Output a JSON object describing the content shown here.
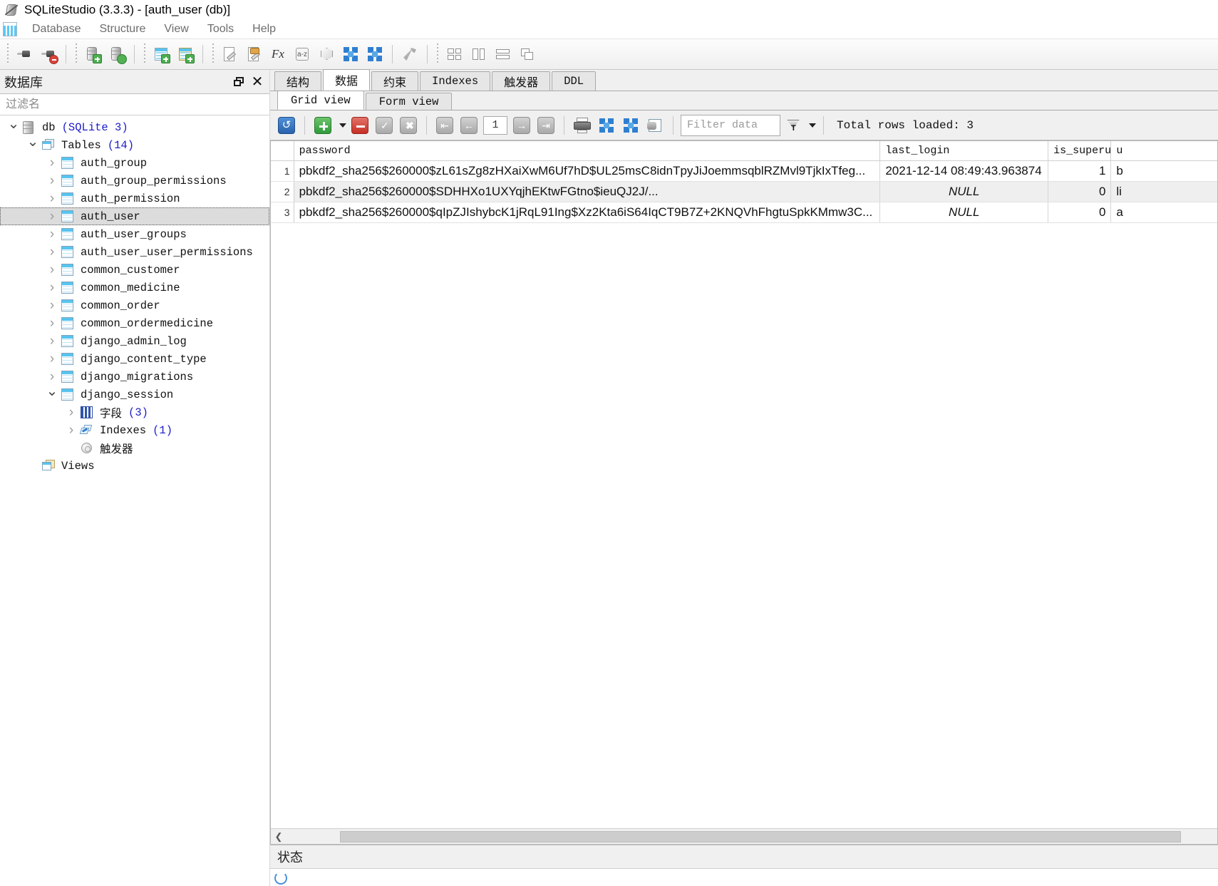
{
  "window": {
    "title": "SQLiteStudio (3.3.3) - [auth_user (db)]",
    "app_icon": "sqlite-logo-icon"
  },
  "menubar": {
    "items": [
      {
        "label": "Database",
        "name": "menu-database"
      },
      {
        "label": "Structure",
        "name": "menu-structure"
      },
      {
        "label": "View",
        "name": "menu-view"
      },
      {
        "label": "Tools",
        "name": "menu-tools"
      },
      {
        "label": "Help",
        "name": "menu-help"
      }
    ]
  },
  "toolbar": {
    "buttons": [
      {
        "name": "connect-to-database-button",
        "icon": "plug-connect-icon"
      },
      {
        "name": "disconnect-from-database-button",
        "icon": "plug-disconnect-icon"
      },
      {
        "name": "add-database-button",
        "icon": "database-add-icon"
      },
      {
        "name": "edit-database-button",
        "icon": "database-edit-icon"
      },
      {
        "name": "create-table-button",
        "icon": "table-add-icon"
      },
      {
        "name": "create-index-button",
        "icon": "index-add-icon"
      },
      {
        "name": "open-sql-editor-button",
        "icon": "sql-editor-icon"
      },
      {
        "name": "open-function-editor-button",
        "icon": "function-editor-icon"
      },
      {
        "name": "custom-sql-functions-button",
        "icon": "fx-icon"
      },
      {
        "name": "collations-editor-button",
        "icon": "a-z-icon"
      },
      {
        "name": "extensions-button",
        "icon": "cube-icon"
      },
      {
        "name": "import-button",
        "icon": "import-icon"
      },
      {
        "name": "export-button",
        "icon": "export-icon"
      },
      {
        "name": "open-configuration-button",
        "icon": "wrench-icon"
      },
      {
        "name": "tile-windows-button",
        "icon": "tile-windows-icon"
      },
      {
        "name": "tile-vertically-button",
        "icon": "tile-vertical-icon"
      },
      {
        "name": "tile-horizontally-button",
        "icon": "tile-horizontal-icon"
      },
      {
        "name": "cascade-windows-button",
        "icon": "cascade-windows-icon"
      }
    ]
  },
  "sidebar": {
    "title": "数据库",
    "float_icon": "restore-window-icon",
    "close_icon": "close-icon",
    "filter_placeholder": "过滤名",
    "tree": [
      {
        "label": "db",
        "suffix": "(SQLite 3)",
        "icon": "database-icon",
        "arrow": "down",
        "indent": 0,
        "name": "tree-node-db"
      },
      {
        "label": "Tables",
        "suffix": "(14)",
        "icon": "tables-folder-icon",
        "arrow": "down",
        "indent": 1,
        "name": "tree-node-tables"
      },
      {
        "label": "auth_group",
        "suffix": "",
        "icon": "table-icon",
        "arrow": "right",
        "indent": 2,
        "name": "tree-node-auth-group"
      },
      {
        "label": "auth_group_permissions",
        "suffix": "",
        "icon": "table-icon",
        "arrow": "right",
        "indent": 2,
        "name": "tree-node-auth-group-permissions"
      },
      {
        "label": "auth_permission",
        "suffix": "",
        "icon": "table-icon",
        "arrow": "right",
        "indent": 2,
        "name": "tree-node-auth-permission"
      },
      {
        "label": "auth_user",
        "suffix": "",
        "icon": "table-icon",
        "arrow": "right",
        "indent": 2,
        "selected": true,
        "name": "tree-node-auth-user"
      },
      {
        "label": "auth_user_groups",
        "suffix": "",
        "icon": "table-icon",
        "arrow": "right",
        "indent": 2,
        "name": "tree-node-auth-user-groups"
      },
      {
        "label": "auth_user_user_permissions",
        "suffix": "",
        "icon": "table-icon",
        "arrow": "right",
        "indent": 2,
        "name": "tree-node-auth-user-user-permissions"
      },
      {
        "label": "common_customer",
        "suffix": "",
        "icon": "table-icon",
        "arrow": "right",
        "indent": 2,
        "name": "tree-node-common-customer"
      },
      {
        "label": "common_medicine",
        "suffix": "",
        "icon": "table-icon",
        "arrow": "right",
        "indent": 2,
        "name": "tree-node-common-medicine"
      },
      {
        "label": "common_order",
        "suffix": "",
        "icon": "table-icon",
        "arrow": "right",
        "indent": 2,
        "name": "tree-node-common-order"
      },
      {
        "label": "common_ordermedicine",
        "suffix": "",
        "icon": "table-icon",
        "arrow": "right",
        "indent": 2,
        "name": "tree-node-common-ordermedicine"
      },
      {
        "label": "django_admin_log",
        "suffix": "",
        "icon": "table-icon",
        "arrow": "right",
        "indent": 2,
        "name": "tree-node-django-admin-log"
      },
      {
        "label": "django_content_type",
        "suffix": "",
        "icon": "table-icon",
        "arrow": "right",
        "indent": 2,
        "name": "tree-node-django-content-type"
      },
      {
        "label": "django_migrations",
        "suffix": "",
        "icon": "table-icon",
        "arrow": "right",
        "indent": 2,
        "name": "tree-node-django-migrations"
      },
      {
        "label": "django_session",
        "suffix": "",
        "icon": "table-icon",
        "arrow": "down",
        "indent": 2,
        "name": "tree-node-django-session"
      },
      {
        "label": "字段",
        "suffix": "(3)",
        "icon": "columns-icon",
        "arrow": "right",
        "indent": 3,
        "cjk": true,
        "name": "tree-node-columns"
      },
      {
        "label": "Indexes",
        "suffix": "(1)",
        "icon": "indexes-icon",
        "arrow": "right",
        "indent": 3,
        "name": "tree-node-indexes"
      },
      {
        "label": "触发器",
        "suffix": "",
        "icon": "triggers-icon",
        "arrow": "none",
        "indent": 3,
        "cjk": true,
        "name": "tree-node-triggers"
      },
      {
        "label": "Views",
        "suffix": "",
        "icon": "views-icon",
        "arrow": "none",
        "indent": 1,
        "name": "tree-node-views"
      }
    ]
  },
  "main": {
    "tabs": [
      {
        "label": "结构",
        "active": false,
        "cjk": true,
        "name": "tab-structure"
      },
      {
        "label": "数据",
        "active": true,
        "cjk": true,
        "name": "tab-data"
      },
      {
        "label": "约束",
        "active": false,
        "cjk": true,
        "name": "tab-constraints"
      },
      {
        "label": "Indexes",
        "active": false,
        "cjk": false,
        "name": "tab-indexes"
      },
      {
        "label": "触发器",
        "active": false,
        "cjk": true,
        "name": "tab-triggers"
      },
      {
        "label": "DDL",
        "active": false,
        "cjk": false,
        "name": "tab-ddl"
      }
    ],
    "subtabs": [
      {
        "label": "Grid view",
        "active": true,
        "name": "subtab-grid-view"
      },
      {
        "label": "Form view",
        "active": false,
        "name": "subtab-form-view"
      }
    ],
    "gridtools": {
      "refresh_icon": "refresh-icon",
      "insert_row_icon": "insert-row-icon",
      "insert_row_dropdown_icon": "chevron-down-icon",
      "delete_row_icon": "delete-row-icon",
      "commit_icon": "commit-changes-icon",
      "rollback_icon": "rollback-changes-icon",
      "first_page_icon": "first-page-icon",
      "prev_page_icon": "previous-page-icon",
      "page_value": "1",
      "next_page_icon": "next-page-icon",
      "last_page_icon": "last-page-icon",
      "print_icon": "print-icon",
      "import_icon": "import-icon",
      "export_icon": "export-icon",
      "populate_icon": "populate-table-icon",
      "filter_placeholder": "Filter data",
      "filter_value": "",
      "filter_mode_icon": "filter-funnel-icon",
      "filter_dropdown_icon": "chevron-down-icon",
      "total_rows_text": "Total rows loaded: 3"
    },
    "grid": {
      "columns": [
        "password",
        "last_login",
        "is_superu",
        "u"
      ],
      "rows": [
        {
          "num": "1",
          "password": "pbkdf2_sha256$260000$zL61sZg8zHXaiXwM6Uf7hD$UL25msC8idnTpyJiJoemmsqblRZMvl9TjkIxTfeg...",
          "last_login": "2021-12-14 08:49:43.963874",
          "is_superuser": "1",
          "username": "b"
        },
        {
          "num": "2",
          "password": "pbkdf2_sha256$260000$SDHHXo1UXYqjhEKtwFGtno$ieuQJ2J/...",
          "last_login": "NULL",
          "is_superuser": "0",
          "username": "li"
        },
        {
          "num": "3",
          "password": "pbkdf2_sha256$260000$qIpZJIshybcK1jRqL91Ing$Xz2Kta6iS64IqCT9B7Z+2KNQVhFhgtuSpkKMmw3C...",
          "last_login": "NULL",
          "is_superuser": "0",
          "username": "a"
        }
      ]
    },
    "scroll_left_icon": "scroll-left-icon"
  },
  "status": {
    "title": "状态"
  },
  "colors": {
    "accent_blue": "#2f7fd1",
    "count_blue": "#1b1bc9",
    "selection_grey": "#dcdcdc",
    "alt_row": "#efefef",
    "null_text": "#8a8a8a"
  }
}
